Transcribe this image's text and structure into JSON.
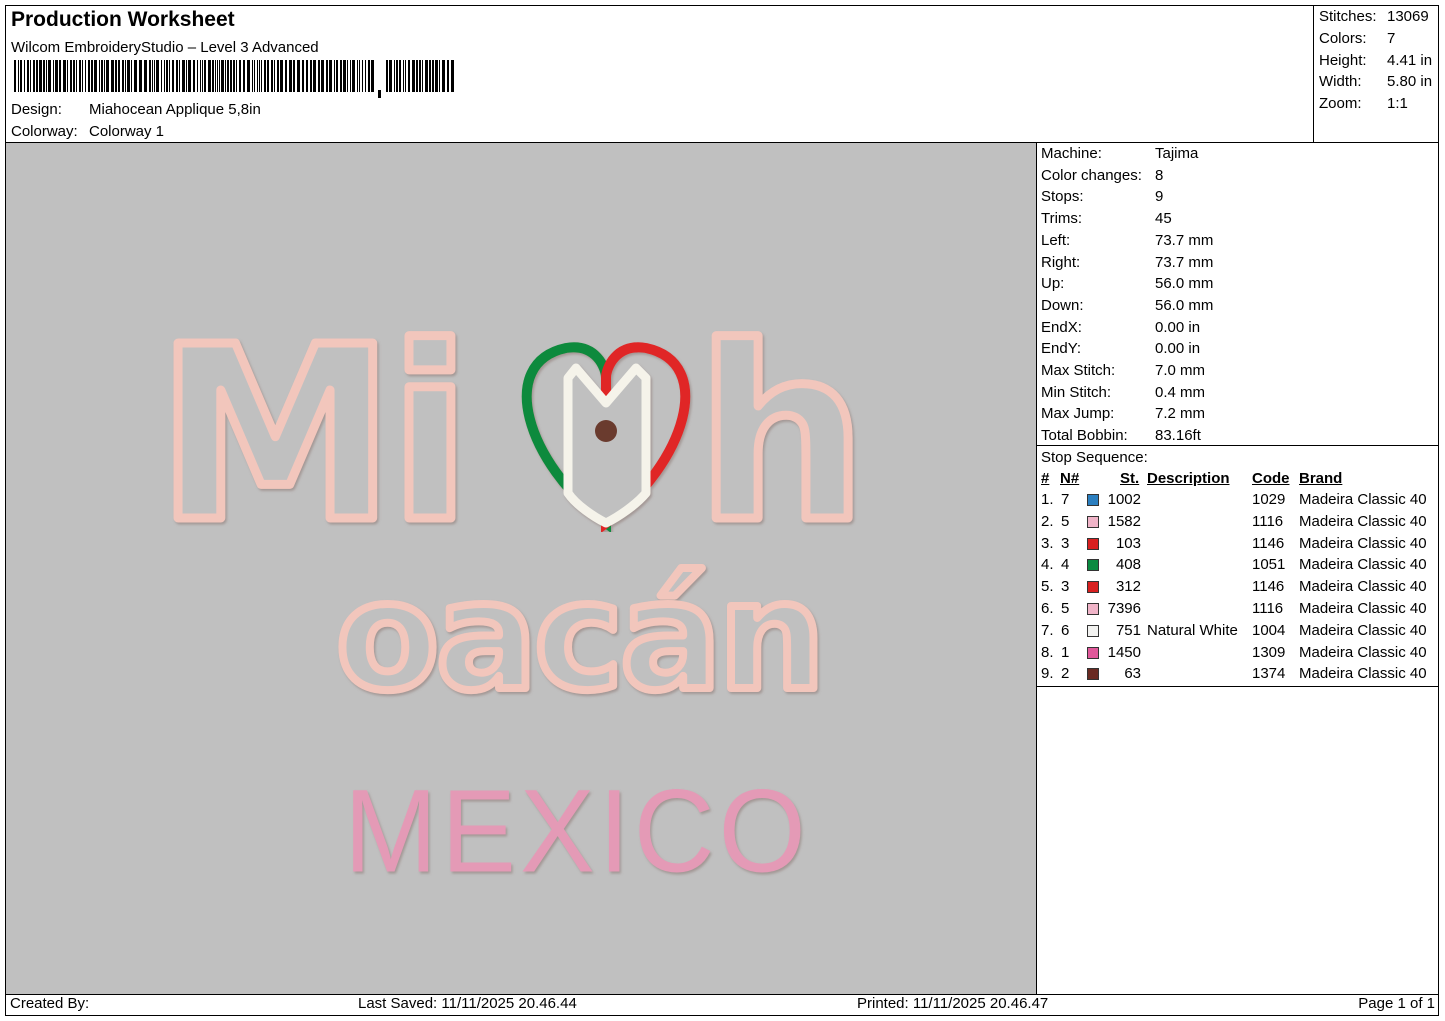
{
  "header": {
    "title": "Production Worksheet",
    "software": "Wilcom EmbroideryStudio – Level 3 Advanced",
    "design_label": "Design:",
    "design_value": "Miahocean Applique 5,8in",
    "colorway_label": "Colorway:",
    "colorway_value": "Colorway 1"
  },
  "stats": [
    {
      "label": "Stitches:",
      "value": "13069"
    },
    {
      "label": "Colors:",
      "value": "7"
    },
    {
      "label": "Height:",
      "value": "4.41 in"
    },
    {
      "label": "Width:",
      "value": "5.80 in"
    },
    {
      "label": "Zoom:",
      "value": "1:1"
    }
  ],
  "machine": [
    {
      "label": "Machine:",
      "value": "Tajima"
    },
    {
      "label": "Color changes:",
      "value": "8"
    },
    {
      "label": "Stops:",
      "value": "9"
    },
    {
      "label": "Trims:",
      "value": "45"
    },
    {
      "label": "Left:",
      "value": "73.7 mm"
    },
    {
      "label": "Right:",
      "value": "73.7 mm"
    },
    {
      "label": "Up:",
      "value": "56.0 mm"
    },
    {
      "label": "Down:",
      "value": "56.0 mm"
    },
    {
      "label": "EndX:",
      "value": "0.00 in"
    },
    {
      "label": "EndY:",
      "value": "0.00 in"
    },
    {
      "label": "Max Stitch:",
      "value": "7.0 mm"
    },
    {
      "label": "Min Stitch:",
      "value": "0.4 mm"
    },
    {
      "label": "Max Jump:",
      "value": "7.2 mm"
    },
    {
      "label": "Total Bobbin:",
      "value": "83.16ft"
    }
  ],
  "stop_sequence": {
    "title": "Stop Sequence:",
    "columns": {
      "num": "#",
      "n": "N#",
      "st": "St.",
      "description": "Description",
      "code": "Code",
      "brand": "Brand"
    },
    "rows": [
      {
        "num": "1.",
        "n": "7",
        "color": "#2b7fc0",
        "st": "1002",
        "description": "",
        "code": "1029",
        "brand": "Madeira Classic 40"
      },
      {
        "num": "2.",
        "n": "5",
        "color": "#f0b4c8",
        "st": "1582",
        "description": "",
        "code": "1116",
        "brand": "Madeira Classic 40"
      },
      {
        "num": "3.",
        "n": "3",
        "color": "#d82020",
        "st": "103",
        "description": "",
        "code": "1146",
        "brand": "Madeira Classic 40"
      },
      {
        "num": "4.",
        "n": "4",
        "color": "#0a8a40",
        "st": "408",
        "description": "",
        "code": "1051",
        "brand": "Madeira Classic 40"
      },
      {
        "num": "5.",
        "n": "3",
        "color": "#d82020",
        "st": "312",
        "description": "",
        "code": "1146",
        "brand": "Madeira Classic 40"
      },
      {
        "num": "6.",
        "n": "5",
        "color": "#f0b4c8",
        "st": "7396",
        "description": "",
        "code": "1116",
        "brand": "Madeira Classic 40"
      },
      {
        "num": "7.",
        "n": "6",
        "color": "#f2f2f0",
        "st": "751",
        "description": "Natural White",
        "code": "1004",
        "brand": "Madeira Classic 40"
      },
      {
        "num": "8.",
        "n": "1",
        "color": "#e0589a",
        "st": "1450",
        "description": "",
        "code": "1309",
        "brand": "Madeira Classic 40"
      },
      {
        "num": "9.",
        "n": "2",
        "color": "#6a2a22",
        "st": "63",
        "description": "",
        "code": "1374",
        "brand": "Madeira Classic 40"
      }
    ]
  },
  "design_preview": {
    "line1": "Mi",
    "line1b": "h",
    "line2": "oacán",
    "line3": "MEXICO",
    "outline_color": "#f2c6bc",
    "outline_shadow": "#c9a49b",
    "mexico_color": "#e49ab6",
    "heart_green": "#0f8a3c",
    "heart_red": "#e02626",
    "heart_white": "#f5f3ea",
    "eagle_dot": "#6b3a2e"
  },
  "footer": {
    "created_by": "Created By:",
    "last_saved": "Last Saved: 11/11/2025 20.46.44",
    "printed": "Printed: 11/11/2025 20.46.47",
    "page": "Page 1 of 1"
  }
}
